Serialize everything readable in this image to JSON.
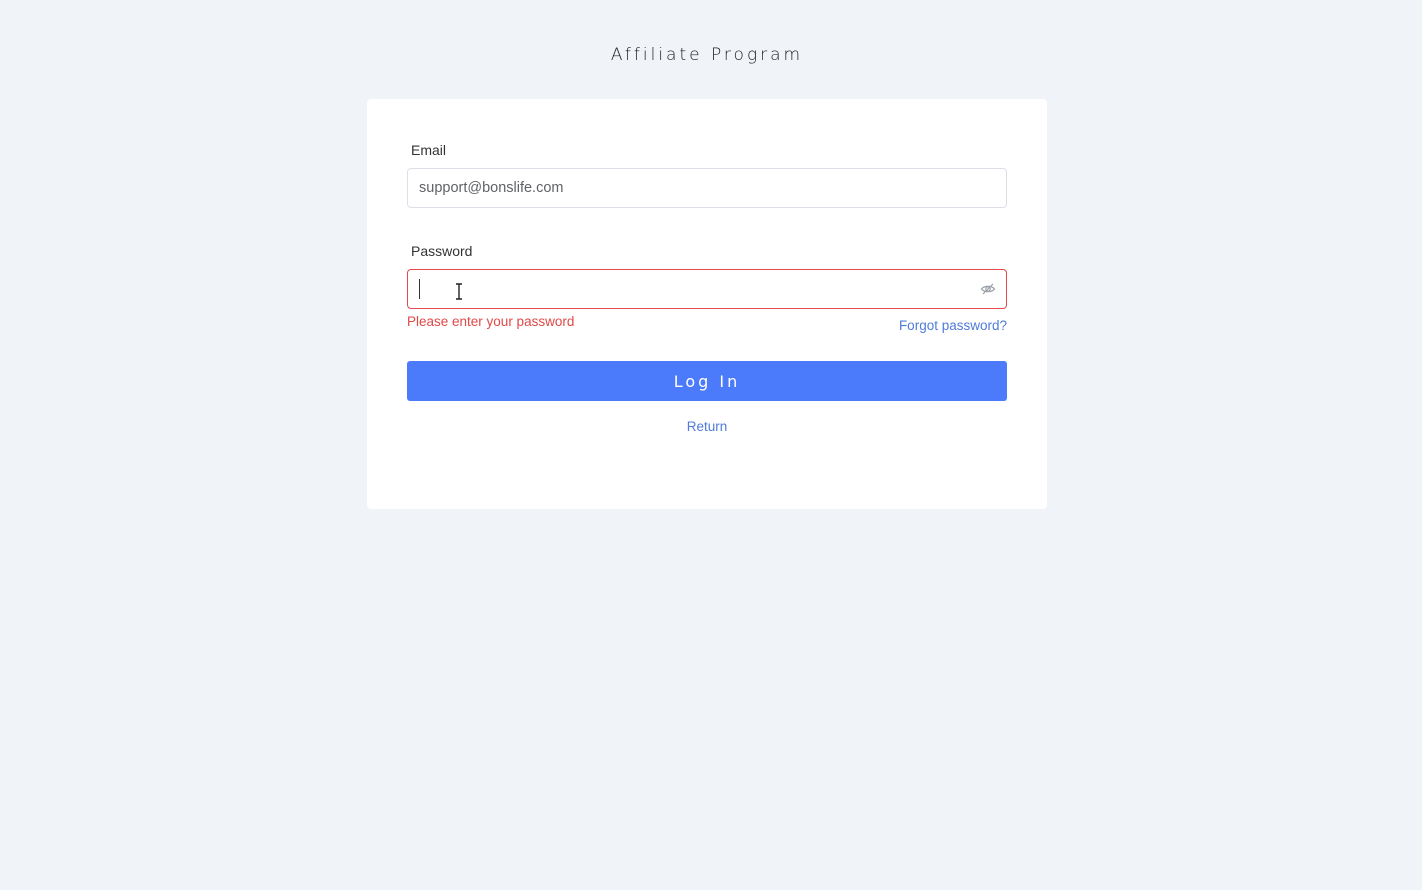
{
  "header": {
    "title": "Affiliate Program"
  },
  "form": {
    "email": {
      "label": "Email",
      "value": "support@bonslife.com"
    },
    "password": {
      "label": "Password",
      "value": "",
      "error": "Please enter your password",
      "toggle_icon": "eye-slash-icon"
    },
    "forgot_label": "Forgot password?",
    "login_label": "Log In",
    "return_label": "Return"
  },
  "colors": {
    "background": "#f0f3f7",
    "card": "#ffffff",
    "primary_button": "#4b7bfa",
    "link": "#4f7bd9",
    "error": "#e04848",
    "error_border": "#e5484d"
  }
}
